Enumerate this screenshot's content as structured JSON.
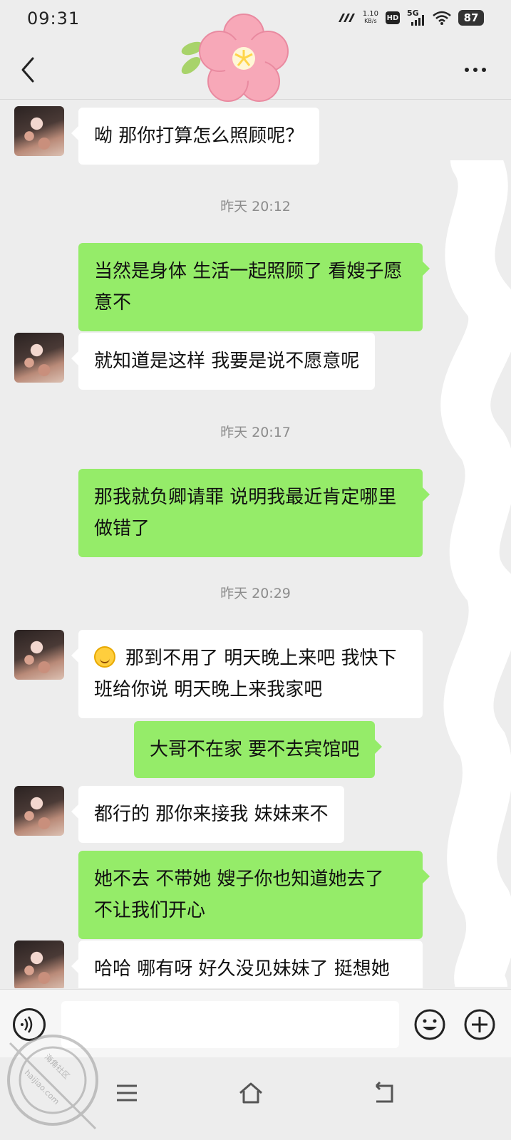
{
  "status_bar": {
    "time": "09:31",
    "net_speed_value": "1.10",
    "net_speed_unit": "KB/s",
    "hd_label": "HD",
    "network_label": "5G",
    "battery": "87"
  },
  "title_bar": {
    "back_icon": "chevron-left-icon",
    "more_icon": "more-horizontal-icon",
    "sticker_icon": "pink-flower-icon"
  },
  "messages": [
    {
      "side": "in",
      "text": "呦  那你打算怎么照顾呢？"
    },
    {
      "timestamp": "昨天 20:12"
    },
    {
      "side": "out",
      "text": "当然是身体  生活一起照顾了  看嫂子愿意不"
    },
    {
      "side": "in",
      "text": "就知道是这样    我要是说不愿意呢"
    },
    {
      "timestamp": "昨天 20:17"
    },
    {
      "side": "out",
      "text": "那我就负卿请罪  说明我最近肯定哪里做错了"
    },
    {
      "timestamp": "昨天 20:29"
    },
    {
      "side": "in",
      "emoji": "smile-emoji",
      "text": "那到不用了  明天晚上来吧  我快下班给你说  明天晚上来我家吧"
    },
    {
      "side": "out",
      "text": "大哥不在家  要不去宾馆吧"
    },
    {
      "side": "in",
      "text": "都行的  那你来接我  妹妹来不"
    },
    {
      "side": "out",
      "text": "她不去  不带她  嫂子你也知道她去了 不让我们开心"
    },
    {
      "side": "in",
      "text": "哈哈  哪有呀  好久没见妹妹了  挺想她的"
    }
  ],
  "input_bar": {
    "voice_icon": "voice-icon",
    "input_value": "",
    "emoji_icon": "emoji-icon",
    "plus_icon": "plus-circle-icon"
  },
  "nav_bar": {
    "menu_icon": "menu-icon",
    "home_icon": "home-icon",
    "back_icon": "back-arrow-icon"
  },
  "watermark": {
    "line1": "海角社区",
    "line2": "haijiao.com"
  },
  "colors": {
    "background": "#ededed",
    "incoming_bubble": "#ffffff",
    "outgoing_bubble": "#95ec69",
    "timestamp_text": "#8c8c8c"
  }
}
